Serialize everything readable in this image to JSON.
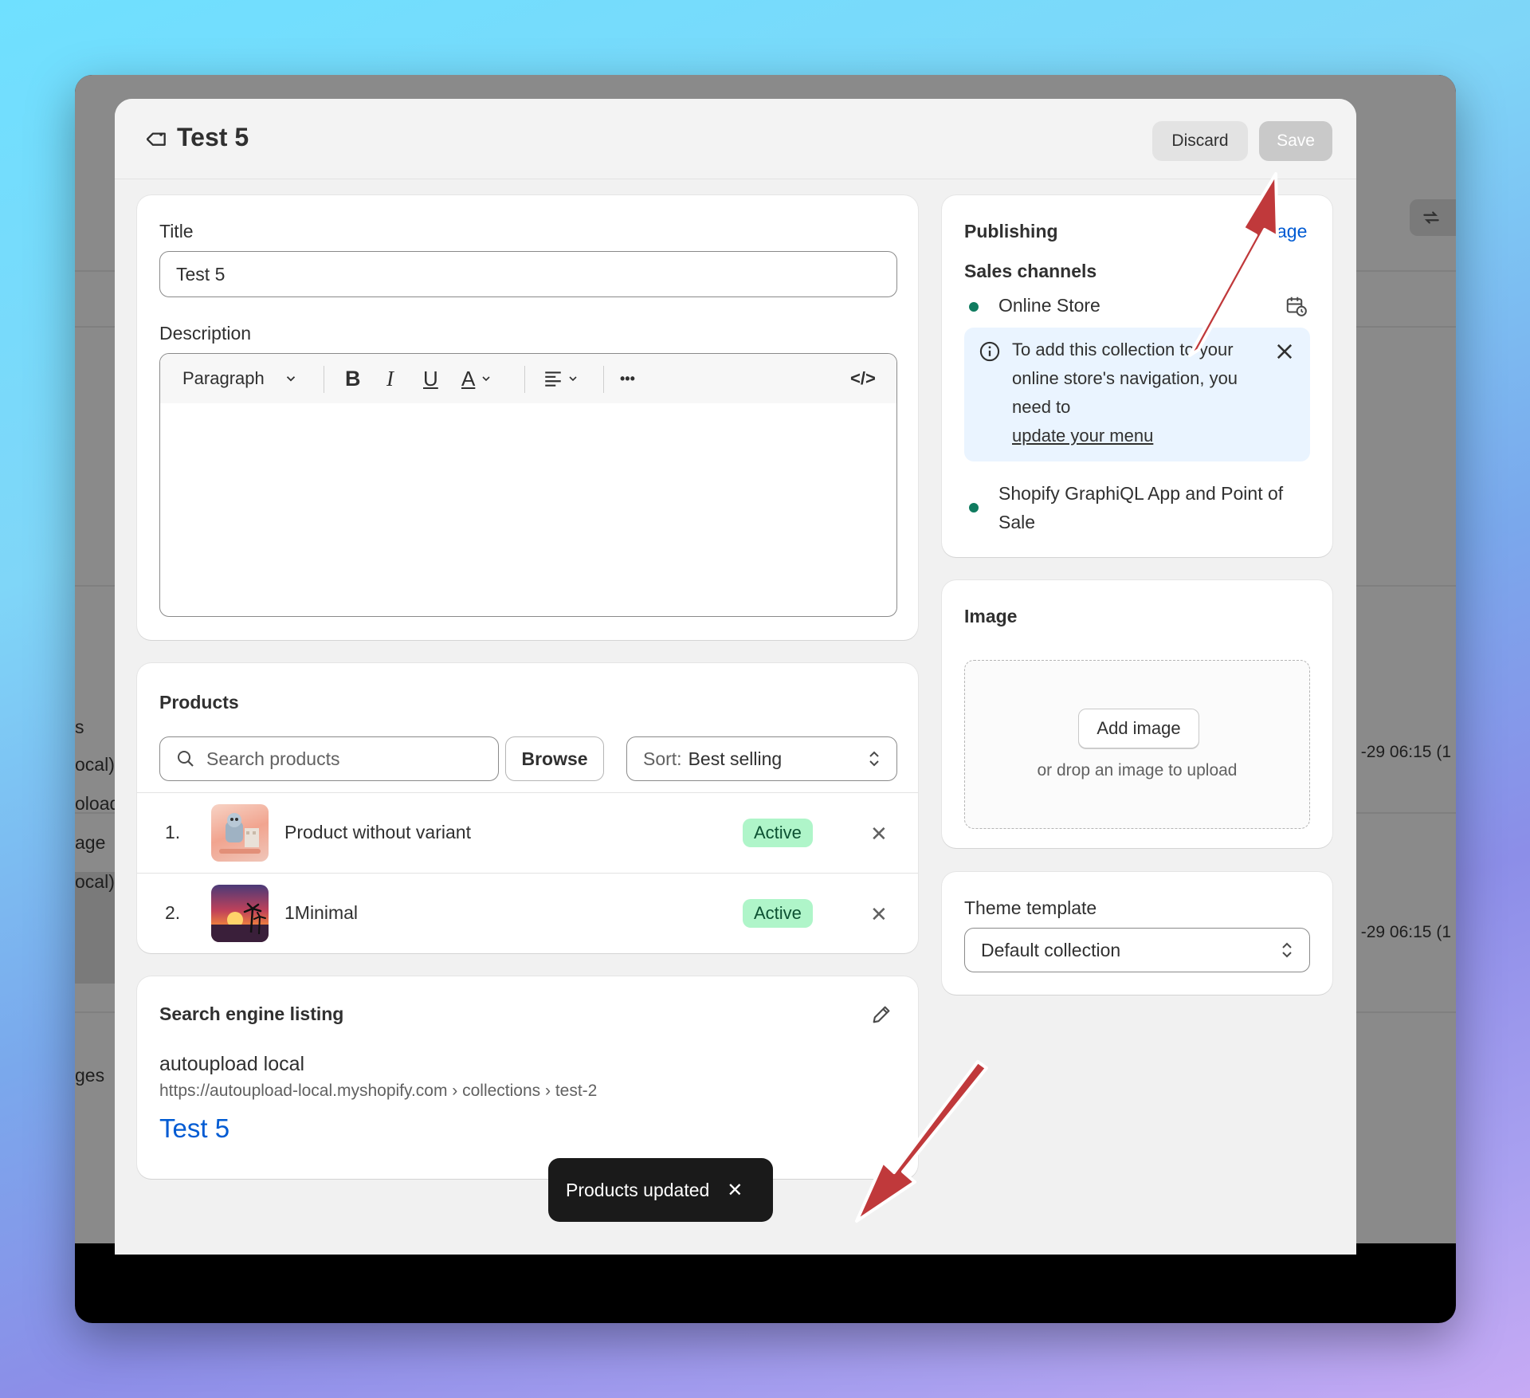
{
  "modal": {
    "title": "Test 5",
    "discard_label": "Discard",
    "save_label": "Save"
  },
  "background": {
    "left_texts": [
      "s",
      "ocal)",
      "oload",
      "age",
      "ocal)",
      "ges"
    ],
    "right_texts": [
      "-29 06:15 (1",
      "-29 06:15 (1"
    ]
  },
  "title_card": {
    "title_label": "Title",
    "title_value": "Test 5",
    "description_label": "Description",
    "paragraph_label": "Paragraph",
    "bold_glyph": "B",
    "italic_glyph": "I",
    "underline_glyph": "U",
    "color_glyph": "A",
    "more_glyph": "•••",
    "code_glyph": "</>"
  },
  "products": {
    "heading": "Products",
    "search_placeholder": "Search products",
    "browse_label": "Browse",
    "sort_prefix": "Sort:",
    "sort_value": "Best selling",
    "items": [
      {
        "number": "1.",
        "name": "Product without variant",
        "status": "Active"
      },
      {
        "number": "2.",
        "name": "1Minimal",
        "status": "Active"
      }
    ]
  },
  "seo": {
    "heading": "Search engine listing",
    "store_name": "autoupload local",
    "url": "https://autoupload-local.myshopify.com › collections › test-2",
    "page_title": "Test 5"
  },
  "publishing": {
    "heading": "Publishing",
    "manage_label": "age",
    "sales_channels_label": "Sales channels",
    "channel_1": "Online Store",
    "banner_text": "To add this collection to your online store's navigation, you need to",
    "banner_link": "update your menu",
    "channel_2": "Shopify GraphiQL App and Point of Sale"
  },
  "image_card": {
    "heading": "Image",
    "add_label": "Add image",
    "drop_text": "or drop an image to upload"
  },
  "theme": {
    "heading": "Theme template",
    "value": "Default collection"
  },
  "toast": {
    "message": "Products updated"
  },
  "colors": {
    "accent_link": "#005bd3",
    "badge_bg": "#aff5c9",
    "badge_text": "#0c5132",
    "annotation_arrow": "#c0393b"
  }
}
